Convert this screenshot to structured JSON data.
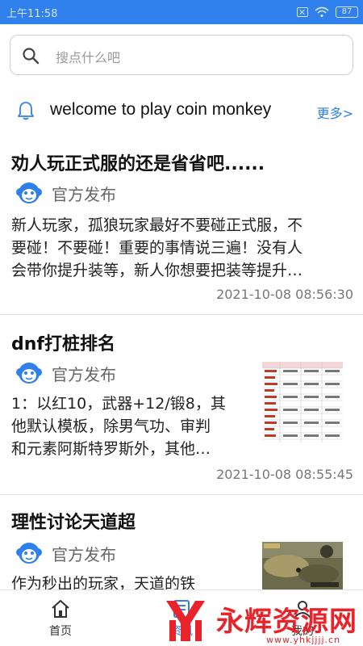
{
  "status_bar": {
    "time": "上午11:58",
    "battery": "87"
  },
  "search": {
    "placeholder": "搜点什么吧"
  },
  "notice": {
    "text": "welcome to play coin monkey",
    "more": "更多>"
  },
  "posts": [
    {
      "title": "劝人玩正式服的还是省省吧......",
      "author": "官方发布",
      "body_lines": [
        "新人玩家，孤狼玩家最好不要碰正式服，不",
        "要碰！不要碰！重要的事情说三遍！没有人",
        "会带你提升装等，新人你想要把装等提升…"
      ],
      "time": "2021-10-08 08:56:30"
    },
    {
      "title": "dnf打桩排名",
      "author": "官方发布",
      "body_lines": [
        "1：以红10，武器+12/锻8，其",
        "他默认模板，除男气功、审判",
        "和元素阿斯特罗斯外，其他…"
      ],
      "time": "2021-10-08 08:55:45"
    },
    {
      "title": "理性讨论天道超",
      "author": "官方发布",
      "body_lines": [
        "作为秒出的玩家，天道的铁"
      ]
    }
  ],
  "tabs": [
    {
      "label": "首页",
      "icon": "home-icon"
    },
    {
      "label": "资讯",
      "icon": "news-icon"
    },
    {
      "label": "我的",
      "icon": "profile-icon"
    }
  ],
  "watermark": {
    "text": "永辉资源网",
    "url": "www.yhkjjjj.cn"
  },
  "colors": {
    "accent": "#2f80ed",
    "watermark": "#e8242a"
  }
}
